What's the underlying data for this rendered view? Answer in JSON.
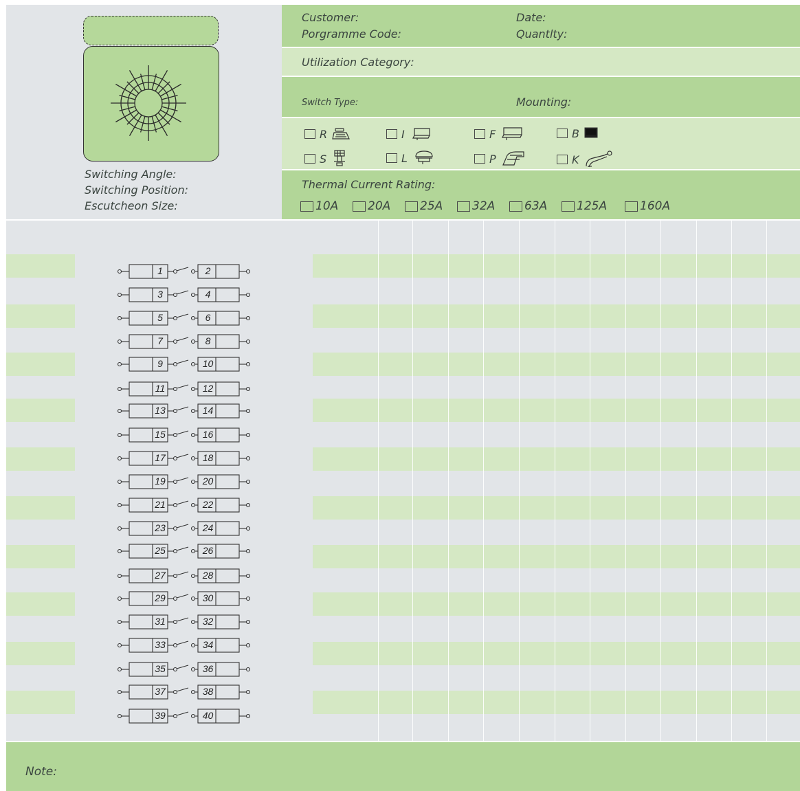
{
  "header": {
    "customer_label": "Customer:",
    "date_label": "Date:",
    "programme_code_label": "Porgramme Code:",
    "quantity_label": "Quantlty:",
    "utilization_label": "Utilization  Category:",
    "switch_type_label": "Switch Type:",
    "mounting_label": "Mounting:",
    "thermal_label": "Thermal Current Rating:"
  },
  "left_panel": {
    "switching_angle_label": "Switching Angle:",
    "switching_position_label": "Switching Position:",
    "escutcheon_size_label": "Escutcheon Size:"
  },
  "mounting_options": [
    {
      "code": "R",
      "icon": "mount-r-icon"
    },
    {
      "code": "I",
      "icon": "mount-i-icon"
    },
    {
      "code": "F",
      "icon": "mount-f-icon"
    },
    {
      "code": "B",
      "icon": "mount-b-icon"
    },
    {
      "code": "S",
      "icon": "mount-s-icon"
    },
    {
      "code": "L",
      "icon": "mount-l-icon"
    },
    {
      "code": "P",
      "icon": "mount-p-icon"
    },
    {
      "code": "K",
      "icon": "mount-k-icon"
    }
  ],
  "ratings": [
    "10A",
    "20A",
    "25A",
    "32A",
    "63A",
    "125A",
    "160A"
  ],
  "contacts": [
    [
      "1",
      "2"
    ],
    [
      "3",
      "4"
    ],
    [
      "5",
      "6"
    ],
    [
      "7",
      "8"
    ],
    [
      "9",
      "10"
    ],
    [
      "11",
      "12"
    ],
    [
      "13",
      "14"
    ],
    [
      "15",
      "16"
    ],
    [
      "17",
      "18"
    ],
    [
      "19",
      "20"
    ],
    [
      "21",
      "22"
    ],
    [
      "23",
      "24"
    ],
    [
      "25",
      "26"
    ],
    [
      "27",
      "28"
    ],
    [
      "29",
      "30"
    ],
    [
      "31",
      "32"
    ],
    [
      "33",
      "34"
    ],
    [
      "35",
      "36"
    ],
    [
      "37",
      "38"
    ],
    [
      "39",
      "40"
    ]
  ],
  "footer": {
    "note_label": "Note:"
  },
  "colors": {
    "green_dark": "#b2d698",
    "green_light": "#d5e8c4",
    "grey_panel": "#e2e5e8",
    "dial_fill": "#b5d89a",
    "line": "#3a3a3a"
  }
}
